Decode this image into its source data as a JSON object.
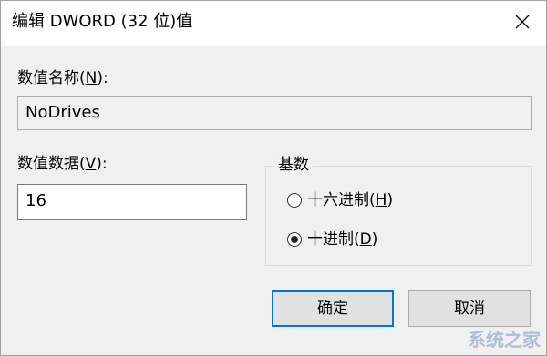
{
  "window": {
    "title": "编辑 DWORD (32 位)值",
    "close_icon": "close-icon"
  },
  "value_name": {
    "label_prefix": "数值名称(",
    "label_key": "N",
    "label_suffix": "):",
    "value": "NoDrives"
  },
  "value_data": {
    "label_prefix": "数值数据(",
    "label_key": "V",
    "label_suffix": "):",
    "value": "16"
  },
  "base": {
    "title": "基数",
    "options": [
      {
        "prefix": "十六进制(",
        "key": "H",
        "suffix": ")",
        "checked": false
      },
      {
        "prefix": "十进制(",
        "key": "D",
        "suffix": ")",
        "checked": true
      }
    ]
  },
  "buttons": {
    "ok": "确定",
    "cancel": "取消"
  },
  "watermark": "系统之家"
}
